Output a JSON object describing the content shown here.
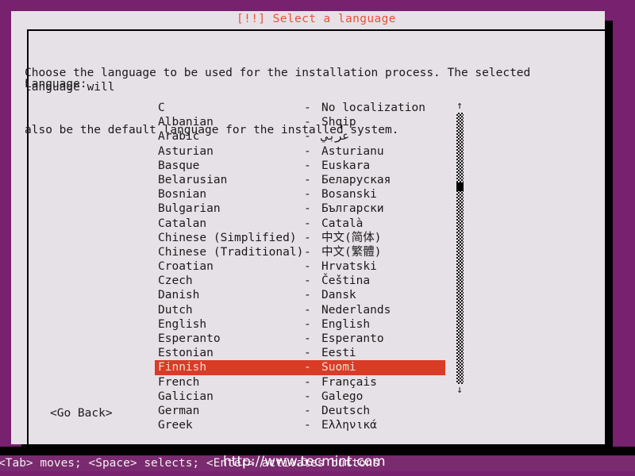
{
  "screen": {
    "background_color": "#77216f",
    "dialog_background": "#e6e1e6",
    "accent_color": "#e9503a",
    "highlight_color": "#da3b27",
    "statusbar_color": "#7a2a6e"
  },
  "dialog": {
    "title": "[!!] Select a language",
    "intro_line_1": "Choose the language to be used for the installation process. The selected language will",
    "intro_line_2": "also be the default language for the installed system.",
    "field_label": "Language:"
  },
  "language_list": {
    "selected_index": 18,
    "separator": "-",
    "items": [
      {
        "name": "C",
        "native": "No localization"
      },
      {
        "name": "Albanian",
        "native": "Shqip"
      },
      {
        "name": "Arabic",
        "native": "عربي"
      },
      {
        "name": "Asturian",
        "native": "Asturianu"
      },
      {
        "name": "Basque",
        "native": "Euskara"
      },
      {
        "name": "Belarusian",
        "native": "Беларуская"
      },
      {
        "name": "Bosnian",
        "native": "Bosanski"
      },
      {
        "name": "Bulgarian",
        "native": "Български"
      },
      {
        "name": "Catalan",
        "native": "Català"
      },
      {
        "name": "Chinese (Simplified)",
        "native": "中文(简体)"
      },
      {
        "name": "Chinese (Traditional)",
        "native": "中文(繁體)"
      },
      {
        "name": "Croatian",
        "native": "Hrvatski"
      },
      {
        "name": "Czech",
        "native": "Čeština"
      },
      {
        "name": "Danish",
        "native": "Dansk"
      },
      {
        "name": "Dutch",
        "native": "Nederlands"
      },
      {
        "name": "English",
        "native": "English"
      },
      {
        "name": "Esperanto",
        "native": "Esperanto"
      },
      {
        "name": "Estonian",
        "native": "Eesti"
      },
      {
        "name": "Finnish",
        "native": "Suomi"
      },
      {
        "name": "French",
        "native": "Français"
      },
      {
        "name": "Galician",
        "native": "Galego"
      },
      {
        "name": "German",
        "native": "Deutsch"
      },
      {
        "name": "Greek",
        "native": "Ελληνικά"
      }
    ]
  },
  "scrollbar": {
    "up_arrow": "↑",
    "down_arrow": "↓"
  },
  "buttons": {
    "go_back": "<Go Back>"
  },
  "statusbar": {
    "text": "<Tab> moves; <Space> selects; <Enter> activates buttons"
  },
  "watermark": {
    "text": "http://www.tecmint.com"
  }
}
